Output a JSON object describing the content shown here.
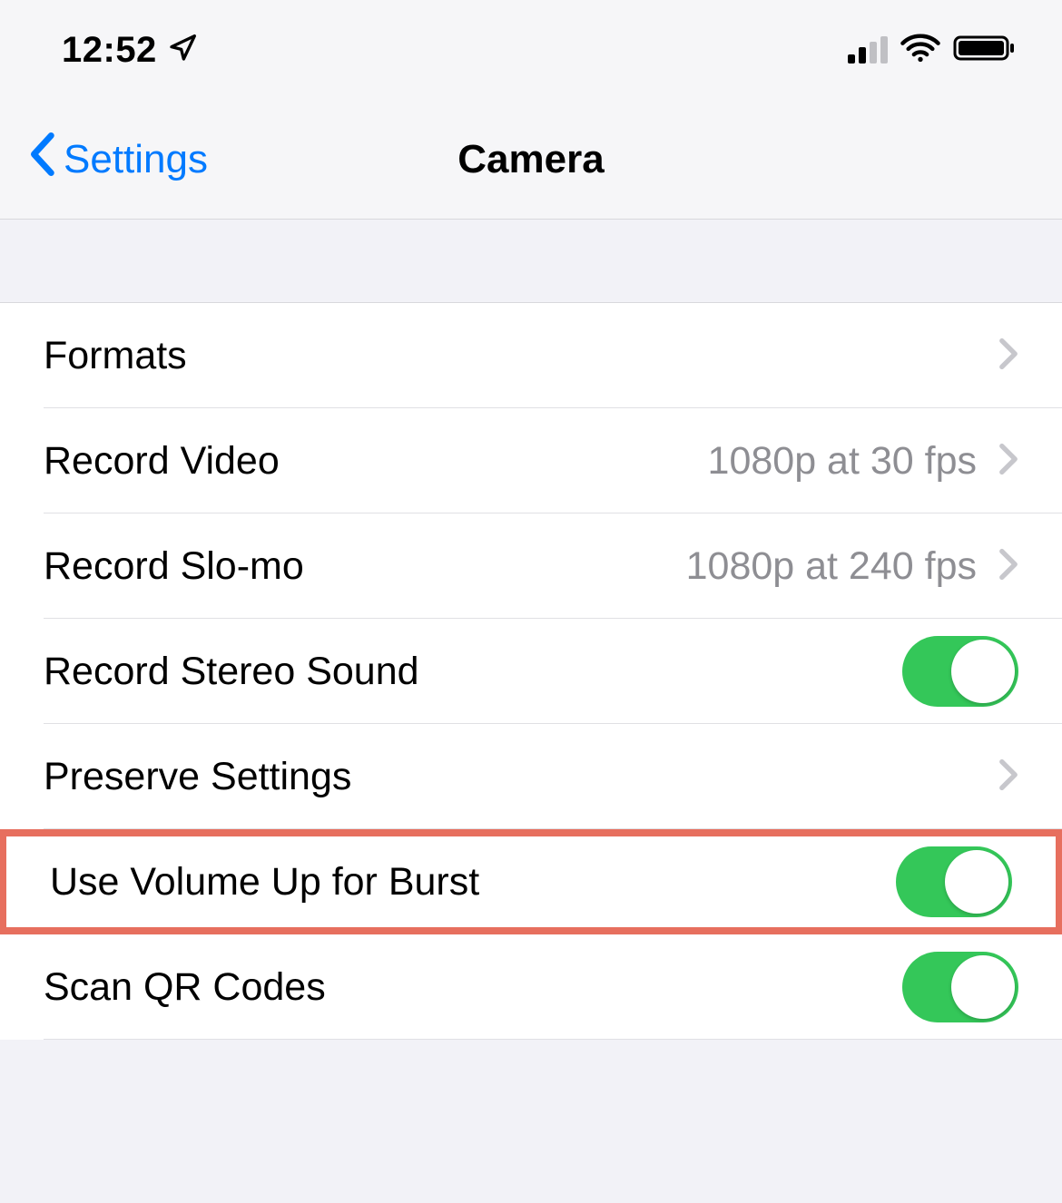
{
  "statusBar": {
    "time": "12:52"
  },
  "navBar": {
    "backLabel": "Settings",
    "title": "Camera"
  },
  "items": {
    "formats": {
      "label": "Formats"
    },
    "recordVideo": {
      "label": "Record Video",
      "value": "1080p at 30 fps"
    },
    "recordSlomo": {
      "label": "Record Slo-mo",
      "value": "1080p at 240 fps"
    },
    "stereoSound": {
      "label": "Record Stereo Sound",
      "on": true
    },
    "preserveSettings": {
      "label": "Preserve Settings"
    },
    "volumeBurst": {
      "label": "Use Volume Up for Burst",
      "on": true
    },
    "scanQR": {
      "label": "Scan QR Codes",
      "on": true
    }
  }
}
